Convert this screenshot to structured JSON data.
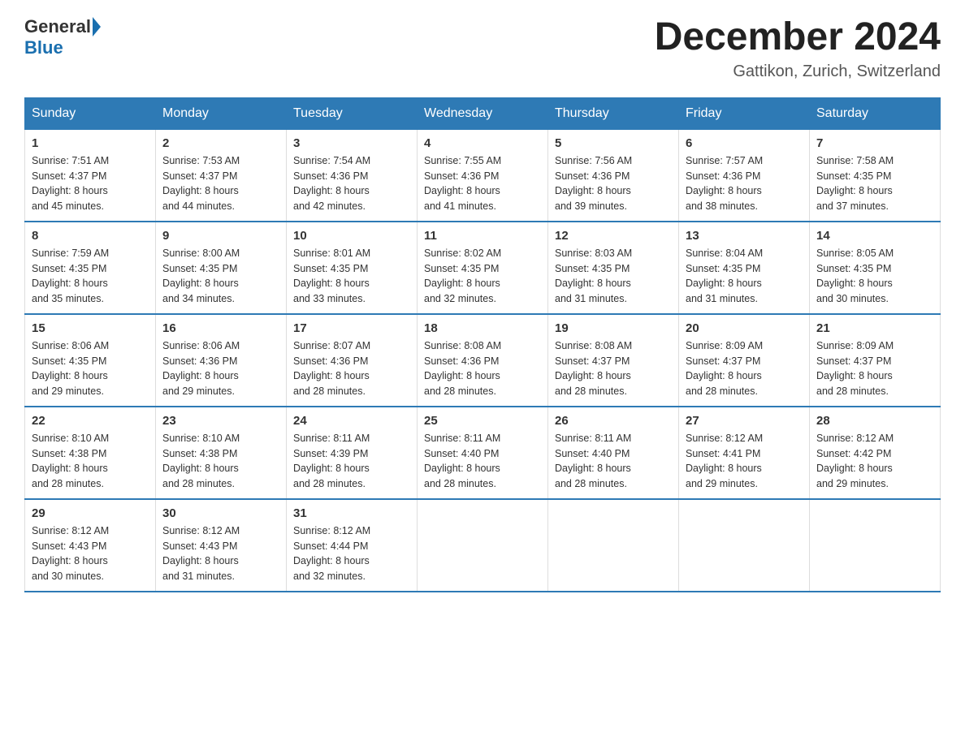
{
  "header": {
    "logo_general": "General",
    "logo_blue": "Blue",
    "month_title": "December 2024",
    "location": "Gattikon, Zurich, Switzerland"
  },
  "columns": [
    "Sunday",
    "Monday",
    "Tuesday",
    "Wednesday",
    "Thursday",
    "Friday",
    "Saturday"
  ],
  "weeks": [
    [
      {
        "day": "1",
        "sunrise": "7:51 AM",
        "sunset": "4:37 PM",
        "daylight": "8 hours and 45 minutes."
      },
      {
        "day": "2",
        "sunrise": "7:53 AM",
        "sunset": "4:37 PM",
        "daylight": "8 hours and 44 minutes."
      },
      {
        "day": "3",
        "sunrise": "7:54 AM",
        "sunset": "4:36 PM",
        "daylight": "8 hours and 42 minutes."
      },
      {
        "day": "4",
        "sunrise": "7:55 AM",
        "sunset": "4:36 PM",
        "daylight": "8 hours and 41 minutes."
      },
      {
        "day": "5",
        "sunrise": "7:56 AM",
        "sunset": "4:36 PM",
        "daylight": "8 hours and 39 minutes."
      },
      {
        "day": "6",
        "sunrise": "7:57 AM",
        "sunset": "4:36 PM",
        "daylight": "8 hours and 38 minutes."
      },
      {
        "day": "7",
        "sunrise": "7:58 AM",
        "sunset": "4:35 PM",
        "daylight": "8 hours and 37 minutes."
      }
    ],
    [
      {
        "day": "8",
        "sunrise": "7:59 AM",
        "sunset": "4:35 PM",
        "daylight": "8 hours and 35 minutes."
      },
      {
        "day": "9",
        "sunrise": "8:00 AM",
        "sunset": "4:35 PM",
        "daylight": "8 hours and 34 minutes."
      },
      {
        "day": "10",
        "sunrise": "8:01 AM",
        "sunset": "4:35 PM",
        "daylight": "8 hours and 33 minutes."
      },
      {
        "day": "11",
        "sunrise": "8:02 AM",
        "sunset": "4:35 PM",
        "daylight": "8 hours and 32 minutes."
      },
      {
        "day": "12",
        "sunrise": "8:03 AM",
        "sunset": "4:35 PM",
        "daylight": "8 hours and 31 minutes."
      },
      {
        "day": "13",
        "sunrise": "8:04 AM",
        "sunset": "4:35 PM",
        "daylight": "8 hours and 31 minutes."
      },
      {
        "day": "14",
        "sunrise": "8:05 AM",
        "sunset": "4:35 PM",
        "daylight": "8 hours and 30 minutes."
      }
    ],
    [
      {
        "day": "15",
        "sunrise": "8:06 AM",
        "sunset": "4:35 PM",
        "daylight": "8 hours and 29 minutes."
      },
      {
        "day": "16",
        "sunrise": "8:06 AM",
        "sunset": "4:36 PM",
        "daylight": "8 hours and 29 minutes."
      },
      {
        "day": "17",
        "sunrise": "8:07 AM",
        "sunset": "4:36 PM",
        "daylight": "8 hours and 28 minutes."
      },
      {
        "day": "18",
        "sunrise": "8:08 AM",
        "sunset": "4:36 PM",
        "daylight": "8 hours and 28 minutes."
      },
      {
        "day": "19",
        "sunrise": "8:08 AM",
        "sunset": "4:37 PM",
        "daylight": "8 hours and 28 minutes."
      },
      {
        "day": "20",
        "sunrise": "8:09 AM",
        "sunset": "4:37 PM",
        "daylight": "8 hours and 28 minutes."
      },
      {
        "day": "21",
        "sunrise": "8:09 AM",
        "sunset": "4:37 PM",
        "daylight": "8 hours and 28 minutes."
      }
    ],
    [
      {
        "day": "22",
        "sunrise": "8:10 AM",
        "sunset": "4:38 PM",
        "daylight": "8 hours and 28 minutes."
      },
      {
        "day": "23",
        "sunrise": "8:10 AM",
        "sunset": "4:38 PM",
        "daylight": "8 hours and 28 minutes."
      },
      {
        "day": "24",
        "sunrise": "8:11 AM",
        "sunset": "4:39 PM",
        "daylight": "8 hours and 28 minutes."
      },
      {
        "day": "25",
        "sunrise": "8:11 AM",
        "sunset": "4:40 PM",
        "daylight": "8 hours and 28 minutes."
      },
      {
        "day": "26",
        "sunrise": "8:11 AM",
        "sunset": "4:40 PM",
        "daylight": "8 hours and 28 minutes."
      },
      {
        "day": "27",
        "sunrise": "8:12 AM",
        "sunset": "4:41 PM",
        "daylight": "8 hours and 29 minutes."
      },
      {
        "day": "28",
        "sunrise": "8:12 AM",
        "sunset": "4:42 PM",
        "daylight": "8 hours and 29 minutes."
      }
    ],
    [
      {
        "day": "29",
        "sunrise": "8:12 AM",
        "sunset": "4:43 PM",
        "daylight": "8 hours and 30 minutes."
      },
      {
        "day": "30",
        "sunrise": "8:12 AM",
        "sunset": "4:43 PM",
        "daylight": "8 hours and 31 minutes."
      },
      {
        "day": "31",
        "sunrise": "8:12 AM",
        "sunset": "4:44 PM",
        "daylight": "8 hours and 32 minutes."
      },
      {
        "day": "",
        "sunrise": "",
        "sunset": "",
        "daylight": ""
      },
      {
        "day": "",
        "sunrise": "",
        "sunset": "",
        "daylight": ""
      },
      {
        "day": "",
        "sunrise": "",
        "sunset": "",
        "daylight": ""
      },
      {
        "day": "",
        "sunrise": "",
        "sunset": "",
        "daylight": ""
      }
    ]
  ],
  "labels": {
    "sunrise_prefix": "Sunrise: ",
    "sunset_prefix": "Sunset: ",
    "daylight_prefix": "Daylight: "
  }
}
